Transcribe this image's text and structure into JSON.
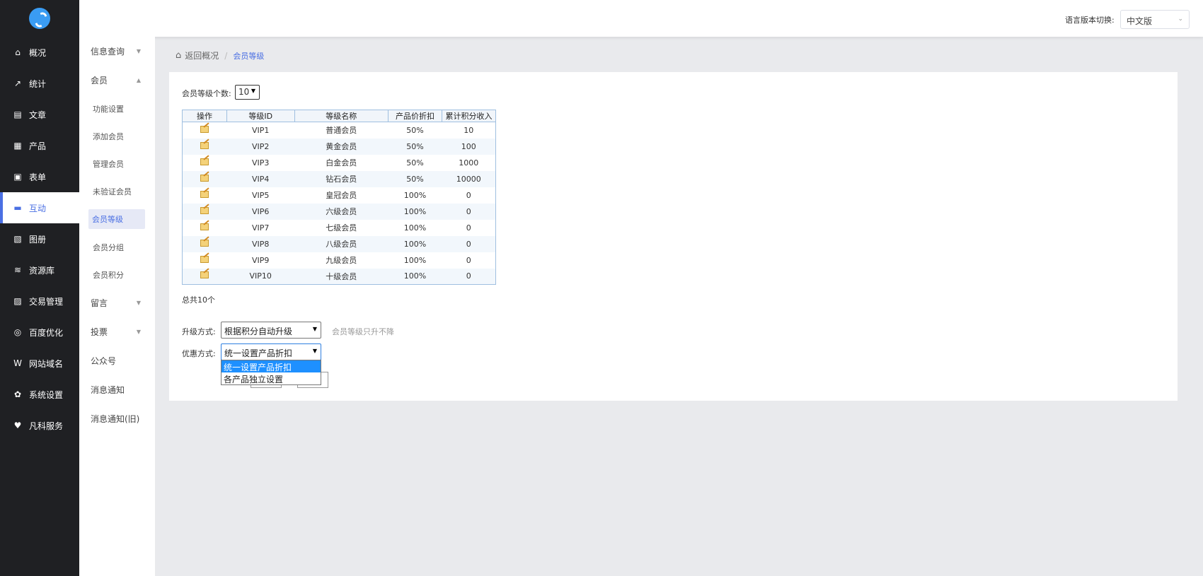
{
  "nav": {
    "items": [
      {
        "label": "概况",
        "icon": "home-icon",
        "glyph": "⌂"
      },
      {
        "label": "统计",
        "icon": "stats-icon",
        "glyph": "↗"
      },
      {
        "label": "文章",
        "icon": "article-icon",
        "glyph": "▤"
      },
      {
        "label": "产品",
        "icon": "product-icon",
        "glyph": "▦"
      },
      {
        "label": "表单",
        "icon": "form-icon",
        "glyph": "▣"
      },
      {
        "label": "互动",
        "icon": "chat-icon",
        "glyph": "▬"
      },
      {
        "label": "图册",
        "icon": "album-icon",
        "glyph": "▧"
      },
      {
        "label": "资源库",
        "icon": "database-icon",
        "glyph": "≋"
      },
      {
        "label": "交易管理",
        "icon": "clipboard-icon",
        "glyph": "▨"
      },
      {
        "label": "百度优化",
        "icon": "refresh-icon",
        "glyph": "◎"
      },
      {
        "label": "网站域名",
        "icon": "website-icon",
        "glyph": "W"
      },
      {
        "label": "系统设置",
        "icon": "gear-icon",
        "glyph": "✿"
      },
      {
        "label": "凡科服务",
        "icon": "heart-icon",
        "glyph": "♥"
      }
    ],
    "active_index": 5
  },
  "subnav": {
    "info": "信息查询",
    "member": "会员",
    "member_children": [
      "功能设置",
      "添加会员",
      "管理会员",
      "未验证会员",
      "会员等级",
      "会员分组",
      "会员积分"
    ],
    "active_child": "会员等级",
    "message": "留言",
    "vote": "投票",
    "official": "公众号",
    "notice": "消息通知",
    "notice_old": "消息通知(旧)"
  },
  "header": {
    "lang_label": "语言版本切换:",
    "lang_value": "中文版"
  },
  "breadcrumb": {
    "back": "返回概况",
    "sep": "/",
    "current": "会员等级"
  },
  "form": {
    "count_label": "会员等级个数:",
    "count_value": "10",
    "total": "总共10个",
    "upgrade_label": "升级方式:",
    "upgrade_value": "根据积分自动升级",
    "upgrade_hint": "会员等级只升不降",
    "discount_label": "优惠方式:",
    "discount_value": "统一设置产品折扣",
    "discount_options": [
      "统一设置产品折扣",
      "各产品独立设置"
    ]
  },
  "table": {
    "headers": [
      "操作",
      "等级ID",
      "等级名称",
      "产品价折扣",
      "累计积分收入"
    ],
    "rows": [
      [
        "VIP1",
        "普通会员",
        "50%",
        "10"
      ],
      [
        "VIP2",
        "黄金会员",
        "50%",
        "100"
      ],
      [
        "VIP3",
        "白金会员",
        "50%",
        "1000"
      ],
      [
        "VIP4",
        "钻石会员",
        "50%",
        "10000"
      ],
      [
        "VIP5",
        "皇冠会员",
        "100%",
        "0"
      ],
      [
        "VIP6",
        "六级会员",
        "100%",
        "0"
      ],
      [
        "VIP7",
        "七级会员",
        "100%",
        "0"
      ],
      [
        "VIP8",
        "八级会员",
        "100%",
        "0"
      ],
      [
        "VIP9",
        "九级会员",
        "100%",
        "0"
      ],
      [
        "VIP10",
        "十级会员",
        "100%",
        "0"
      ]
    ]
  },
  "colors": {
    "accent": "#4a6fe3",
    "nav_bg": "#1f2023",
    "dropdown_highlight": "#1e90ff"
  }
}
